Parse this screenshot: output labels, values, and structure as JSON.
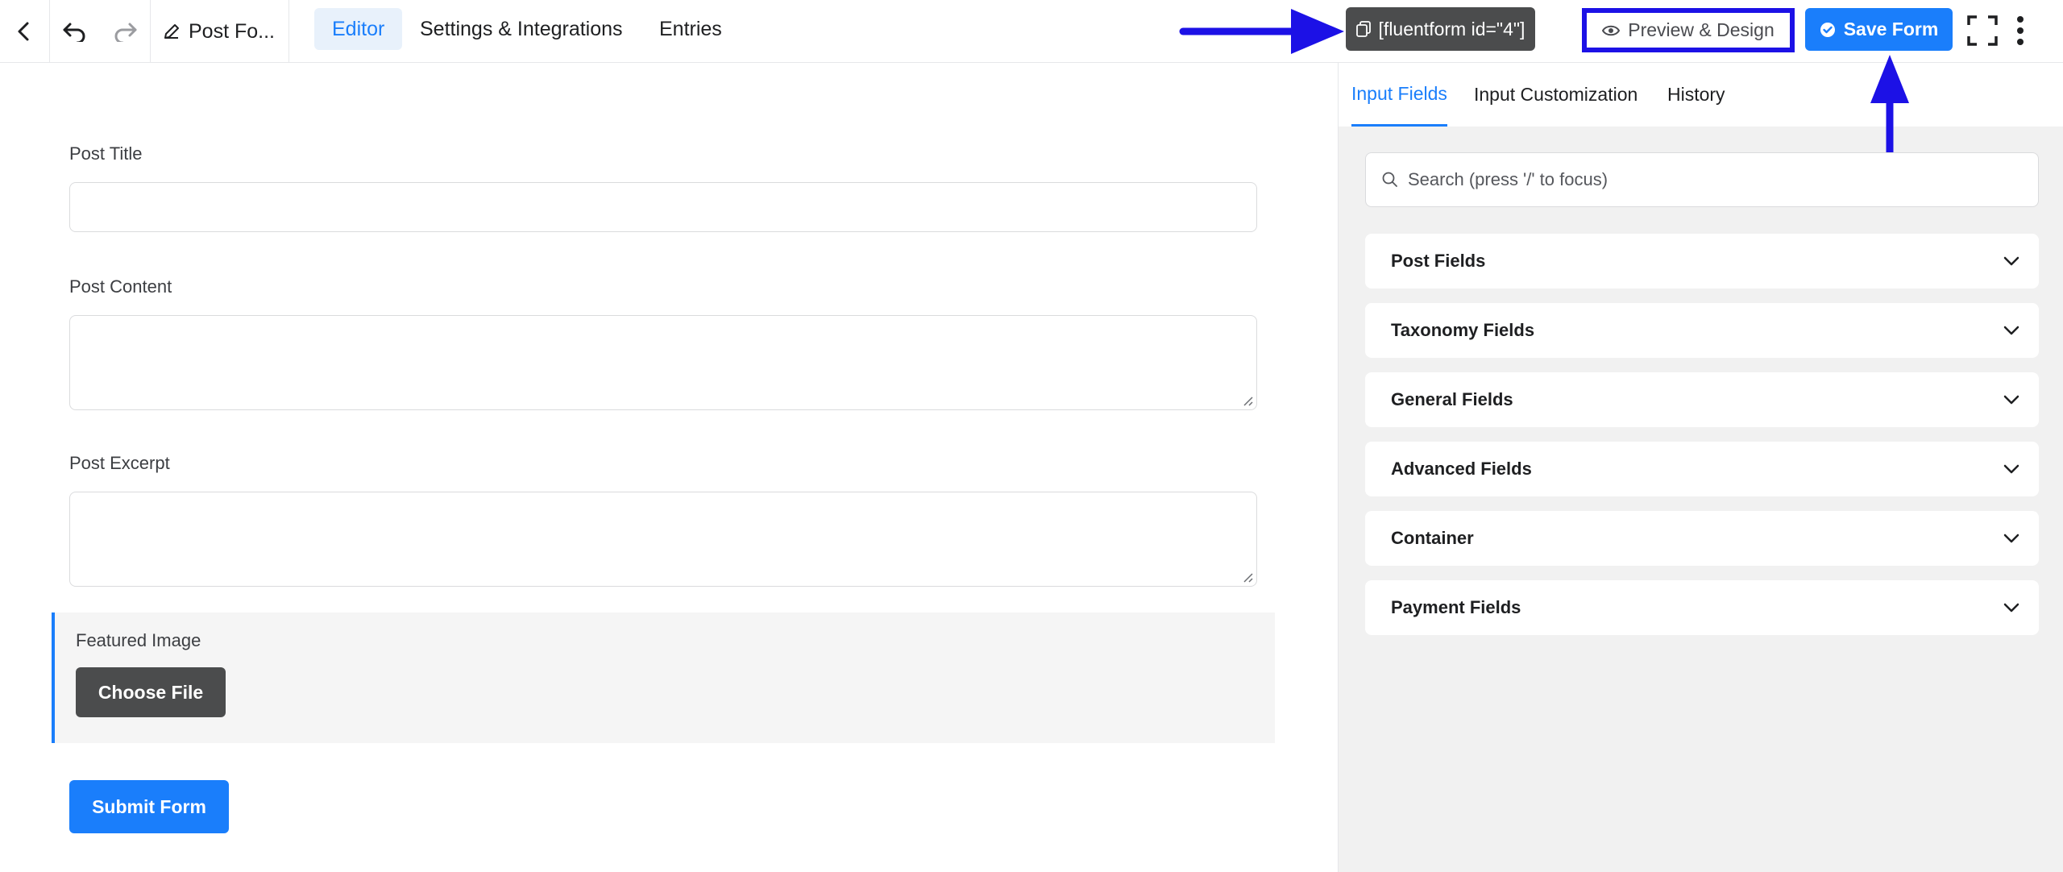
{
  "header": {
    "form_title": "Post Fo...",
    "tabs": [
      {
        "label": "Editor"
      },
      {
        "label": "Settings & Integrations"
      },
      {
        "label": "Entries"
      }
    ],
    "shortcode_label": "[fluentform id=\"4\"]",
    "preview_label": "Preview & Design",
    "save_label": "Save Form"
  },
  "form": {
    "fields": [
      {
        "label": "Post Title"
      },
      {
        "label": "Post Content"
      },
      {
        "label": "Post Excerpt"
      }
    ],
    "upload": {
      "label": "Featured Image",
      "button": "Choose File"
    },
    "submit_label": "Submit Form"
  },
  "sidebar": {
    "tabs": [
      {
        "label": "Input Fields"
      },
      {
        "label": "Input Customization"
      },
      {
        "label": "History"
      }
    ],
    "search": {
      "placeholder": "Search (press '/' to focus)",
      "value": ""
    },
    "groups": [
      {
        "label": "Post Fields"
      },
      {
        "label": "Taxonomy Fields"
      },
      {
        "label": "General Fields"
      },
      {
        "label": "Advanced Fields"
      },
      {
        "label": "Container"
      },
      {
        "label": "Payment Fields"
      }
    ]
  },
  "colors": {
    "accent": "#1a7efb",
    "annotation": "#1c11e6",
    "dark_button": "#4b4c4d"
  },
  "icons": [
    "chevron-left-icon",
    "undo-icon",
    "redo-icon",
    "pencil-icon",
    "copy-icon",
    "eye-icon",
    "check-circle-icon",
    "fullscreen-icon",
    "more-vertical-icon",
    "search-icon",
    "chevron-down-icon",
    "arrow-right-icon",
    "arrow-up-icon"
  ]
}
